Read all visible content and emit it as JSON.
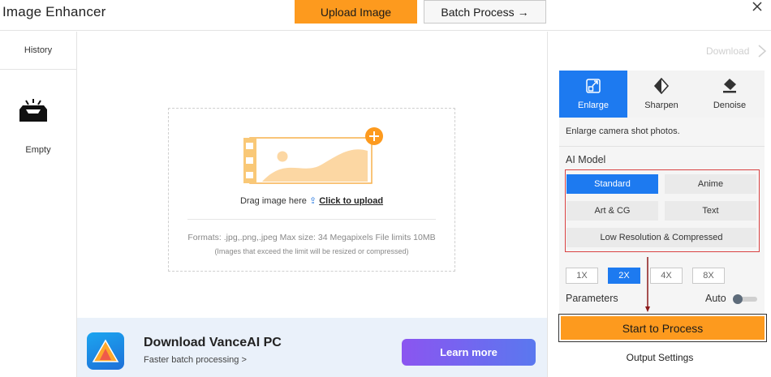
{
  "header": {
    "title": "Image Enhancer",
    "upload_label": "Upload Image",
    "batch_label": "Batch Process →"
  },
  "history": {
    "title": "History",
    "empty_label": "Empty"
  },
  "dropzone": {
    "drag_text": "Drag image here ",
    "click_text": "Click to upload",
    "formats": "Formats: .jpg,.png,.jpeg Max size: 34 Megapixels File limits 10MB",
    "exceed_note": "(Images that exceed the limit will be resized or compressed)"
  },
  "promo": {
    "title": "Download VanceAI PC",
    "subtitle": "Faster batch processing >",
    "learn_label": "Learn more"
  },
  "panel": {
    "download_label": "Download",
    "tabs": [
      {
        "label": "Enlarge",
        "icon": "enlarge-icon",
        "active": true
      },
      {
        "label": "Sharpen",
        "icon": "sharpen-icon",
        "active": false
      },
      {
        "label": "Denoise",
        "icon": "denoise-icon",
        "active": false
      }
    ],
    "description": "Enlarge camera shot photos.",
    "ai_model_label": "AI Model",
    "models": [
      {
        "label": "Standard",
        "selected": true
      },
      {
        "label": "Anime",
        "selected": false
      },
      {
        "label": "Art & CG",
        "selected": false
      },
      {
        "label": "Text",
        "selected": false
      },
      {
        "label": "Low Resolution & Compressed",
        "selected": false
      }
    ],
    "scales": [
      {
        "label": "1X",
        "selected": false
      },
      {
        "label": "2X",
        "selected": true
      },
      {
        "label": "4X",
        "selected": false
      },
      {
        "label": "8X",
        "selected": false
      }
    ],
    "parameters_label": "Parameters",
    "auto_label": "Auto",
    "auto_enabled": false,
    "start_label": "Start to Process",
    "output_label": "Output Settings"
  },
  "colors": {
    "accent_orange": "#fd9a1e",
    "accent_blue": "#1d7af0",
    "highlight_red": "#d94242"
  }
}
